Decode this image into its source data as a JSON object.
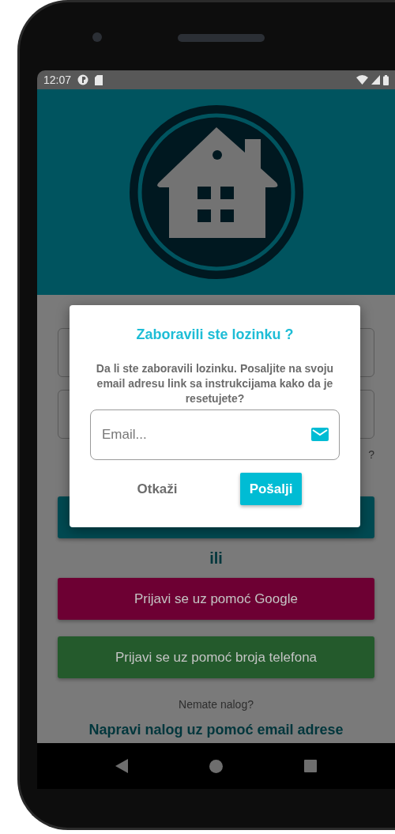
{
  "status_bar": {
    "time": "12:07"
  },
  "login_form": {
    "forgot_link_fragment": "?",
    "separator": "ili",
    "buttons": [
      {
        "label": "Prijavi se uz pomoć Google",
        "kind": "google"
      },
      {
        "label": "Prijavi se uz pomoć broja telefona",
        "kind": "phone"
      }
    ],
    "signup_prompt": "Nemate nalog?",
    "signup_link": "Napravi nalog uz pomoć email adrese"
  },
  "dialog": {
    "title": "Zaboravili ste lozinku ?",
    "message": "Da li ste zaboravili lozinku. Posaljite na svoju email adresu link sa instrukcijama kako da je resetujete?",
    "email_field": {
      "placeholder": "Email..."
    },
    "buttons": [
      {
        "label": "Otkaži",
        "kind": "text"
      },
      {
        "label": "Pošalji",
        "kind": "primary"
      }
    ]
  }
}
